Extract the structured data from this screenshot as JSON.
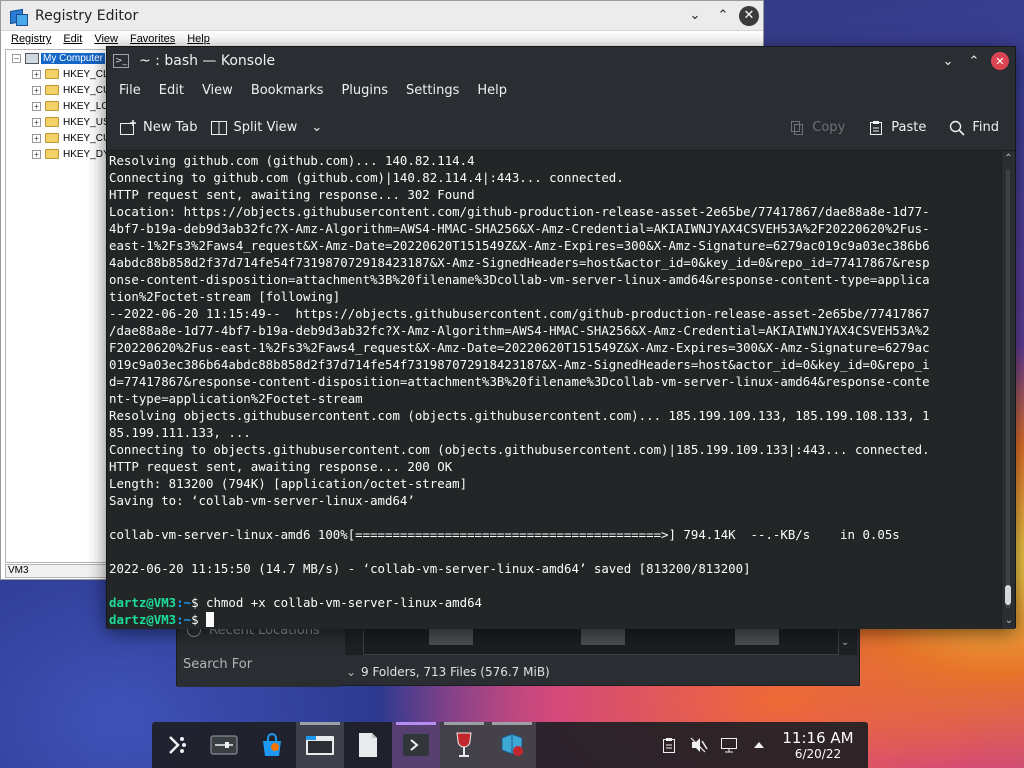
{
  "registry": {
    "title": "Registry Editor",
    "menu": [
      "Registry",
      "Edit",
      "View",
      "Favorites",
      "Help"
    ],
    "tree_root": "My Computer",
    "tree_items": [
      "HKEY_CL",
      "HKEY_CU",
      "HKEY_LO",
      "HKEY_US",
      "HKEY_CU",
      "HKEY_DY"
    ],
    "status": "VM3",
    "window_controls": {
      "minimize": "chevron-down-icon",
      "maximize": "chevron-up-icon",
      "close": "close-icon"
    }
  },
  "dolphin": {
    "recent_locations": "Recent Locations",
    "search_for": "Search For",
    "status": "9 Folders, 713 Files (576.7 MiB)"
  },
  "konsole": {
    "title": "~ : bash — Konsole",
    "menu": [
      "File",
      "Edit",
      "View",
      "Bookmarks",
      "Plugins",
      "Settings",
      "Help"
    ],
    "toolbar": {
      "new_tab": "New Tab",
      "split_view": "Split View",
      "copy": "Copy",
      "paste": "Paste",
      "find": "Find"
    },
    "terminal_lines": [
      "Resolving github.com (github.com)... 140.82.114.4",
      "Connecting to github.com (github.com)|140.82.114.4|:443... connected.",
      "HTTP request sent, awaiting response... 302 Found",
      "Location: https://objects.githubusercontent.com/github-production-release-asset-2e65be/77417867/dae88a8e-1d77-",
      "4bf7-b19a-deb9d3ab32fc?X-Amz-Algorithm=AWS4-HMAC-SHA256&X-Amz-Credential=AKIAIWNJYAX4CSVEH53A%2F20220620%2Fus-",
      "east-1%2Fs3%2Faws4_request&X-Amz-Date=20220620T151549Z&X-Amz-Expires=300&X-Amz-Signature=6279ac019c9a03ec386b6",
      "4abdc88b858d2f37d714fe54f731987072918423187&X-Amz-SignedHeaders=host&actor_id=0&key_id=0&repo_id=77417867&resp",
      "onse-content-disposition=attachment%3B%20filename%3Dcollab-vm-server-linux-amd64&response-content-type=applica",
      "tion%2Foctet-stream [following]",
      "--2022-06-20 11:15:49--  https://objects.githubusercontent.com/github-production-release-asset-2e65be/77417867",
      "/dae88a8e-1d77-4bf7-b19a-deb9d3ab32fc?X-Amz-Algorithm=AWS4-HMAC-SHA256&X-Amz-Credential=AKIAIWNJYAX4CSVEH53A%2",
      "F20220620%2Fus-east-1%2Fs3%2Faws4_request&X-Amz-Date=20220620T151549Z&X-Amz-Expires=300&X-Amz-Signature=6279ac",
      "019c9a03ec386b64abdc88b858d2f37d714fe54f731987072918423187&X-Amz-SignedHeaders=host&actor_id=0&key_id=0&repo_i",
      "d=77417867&response-content-disposition=attachment%3B%20filename%3Dcollab-vm-server-linux-amd64&response-conte",
      "nt-type=application%2Foctet-stream",
      "Resolving objects.githubusercontent.com (objects.githubusercontent.com)... 185.199.109.133, 185.199.108.133, 1",
      "85.199.111.133, ...",
      "Connecting to objects.githubusercontent.com (objects.githubusercontent.com)|185.199.109.133|:443... connected.",
      "HTTP request sent, awaiting response... 200 OK",
      "Length: 813200 (794K) [application/octet-stream]",
      "Saving to: ‘collab-vm-server-linux-amd64’",
      "",
      "collab-vm-server-linux-amd6 100%[=========================================>] 794.14K  --.-KB/s    in 0.05s",
      "",
      "2022-06-20 11:15:50 (14.7 MB/s) - ‘collab-vm-server-linux-amd64’ saved [813200/813200]",
      ""
    ],
    "prompt_user": "dartz@VM3",
    "prompt_path": ":~",
    "prompt_symbol": "$ ",
    "last_command": "chmod +x collab-vm-server-linux-amd64"
  },
  "taskbar": {
    "time": "11:16 AM",
    "date": "6/20/22",
    "launchers": [
      "application-launcher-icon",
      "system-settings-icon",
      "discover-store-icon",
      "dolphin-folder-icon",
      "text-file-icon",
      "konsole-terminal-icon",
      "wine-glass-icon",
      "registry-editor-icon"
    ],
    "tray": [
      "clipboard-icon",
      "volume-muted-icon",
      "network-icon",
      "show-hidden-icons-icon"
    ]
  }
}
